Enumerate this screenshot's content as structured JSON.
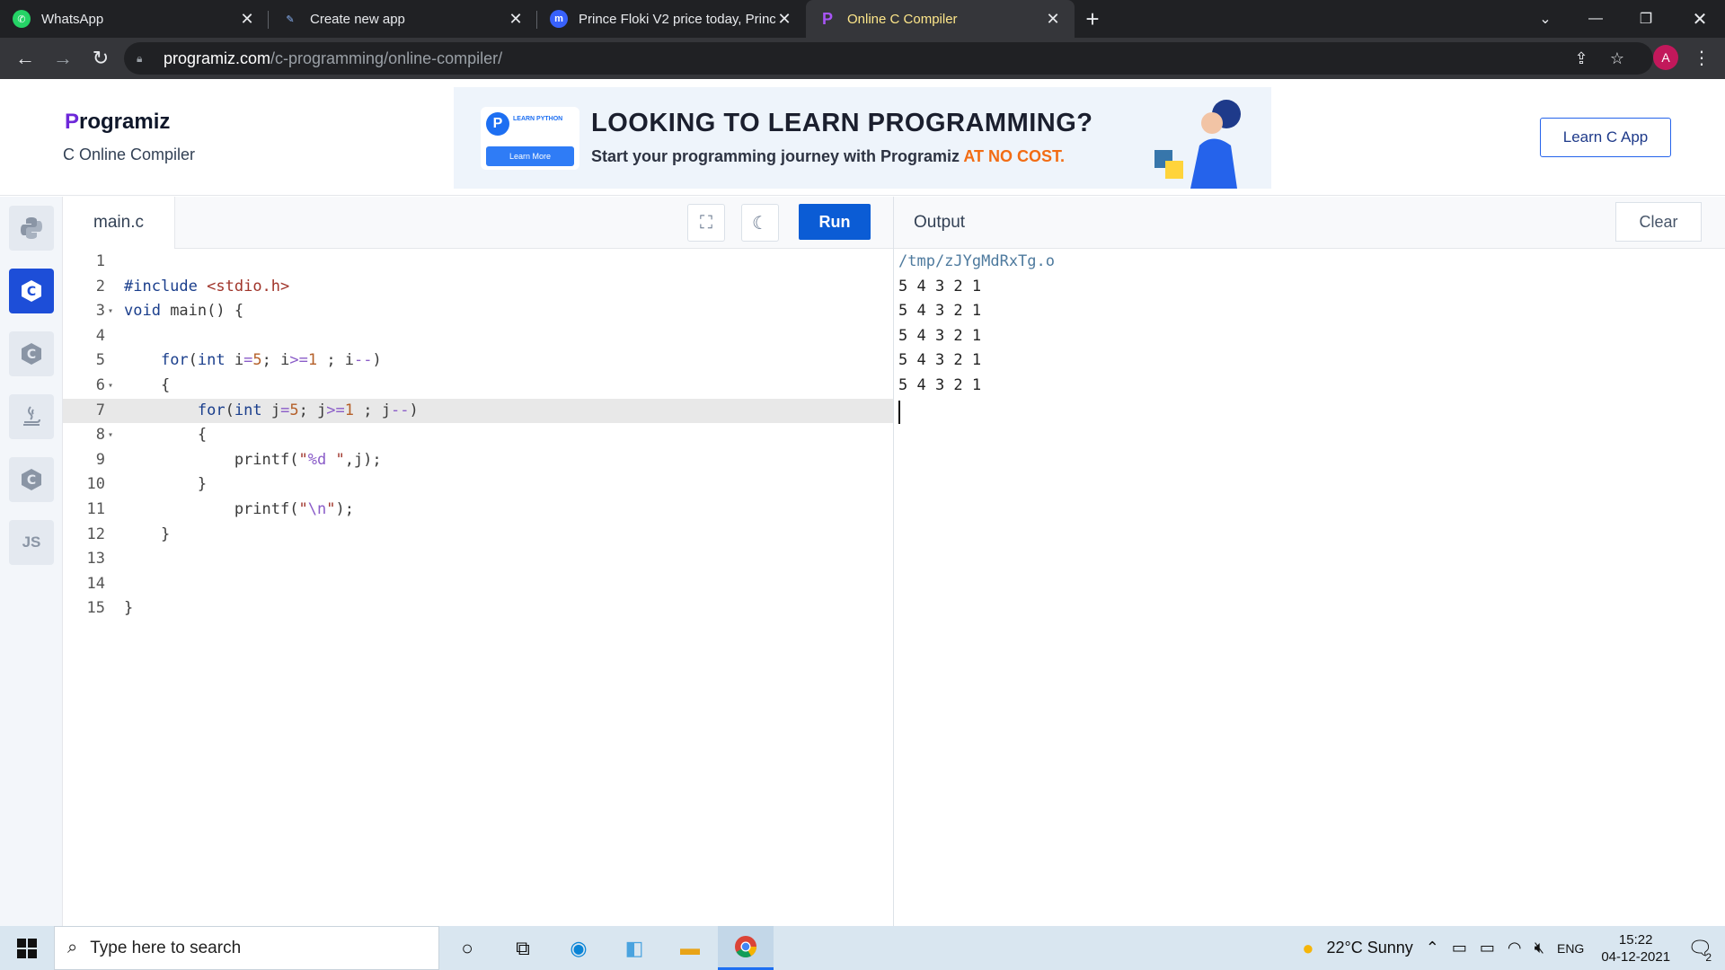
{
  "browser": {
    "tabs": [
      {
        "title": "WhatsApp",
        "icon": "whatsapp-icon"
      },
      {
        "title": "Create new app",
        "icon": "pen-icon"
      },
      {
        "title": "Prince Floki V2 price today, Prince",
        "icon": "coinmarketcap-icon"
      },
      {
        "title": "Online C Compiler",
        "icon": "programiz-icon"
      }
    ],
    "url_host": "programiz.com",
    "url_path": "/c-programming/online-compiler/",
    "avatar_letter": "A"
  },
  "header": {
    "logo_text": "rogramiz",
    "logo_p": "P",
    "subtitle": "C Online Compiler",
    "banner": {
      "headline": "LOOKING TO LEARN PROGRAMMING?",
      "sub_text": "Start your programming journey with Programiz ",
      "sub_highlight": "AT NO COST.",
      "badge_text": "LEARN PYTHON",
      "badge_button": "Learn More"
    },
    "learn_app_label": "Learn C App"
  },
  "editor": {
    "file_name": "main.c",
    "run_label": "Run"
  },
  "output": {
    "title": "Output",
    "clear_label": "Clear",
    "lines": [
      "/tmp/zJYgMdRxTg.o",
      "5 4 3 2 1",
      "5 4 3 2 1",
      "5 4 3 2 1",
      "5 4 3 2 1",
      "5 4 3 2 1"
    ]
  },
  "sidebar": {
    "languages": [
      "python-icon",
      "c-icon",
      "cpp-icon",
      "java-icon",
      "csharp-icon",
      "js-icon"
    ],
    "js_label": "JS"
  },
  "taskbar": {
    "search_placeholder": "Type here to search",
    "weather": "22°C  Sunny",
    "lang": "ENG",
    "time": "15:22",
    "date": "04-12-2021",
    "notifications": "2"
  },
  "colors": {
    "run_button": "#0b5cd5",
    "accent_purple": "#6d28d9",
    "highlight_orange": "#f26c14"
  }
}
